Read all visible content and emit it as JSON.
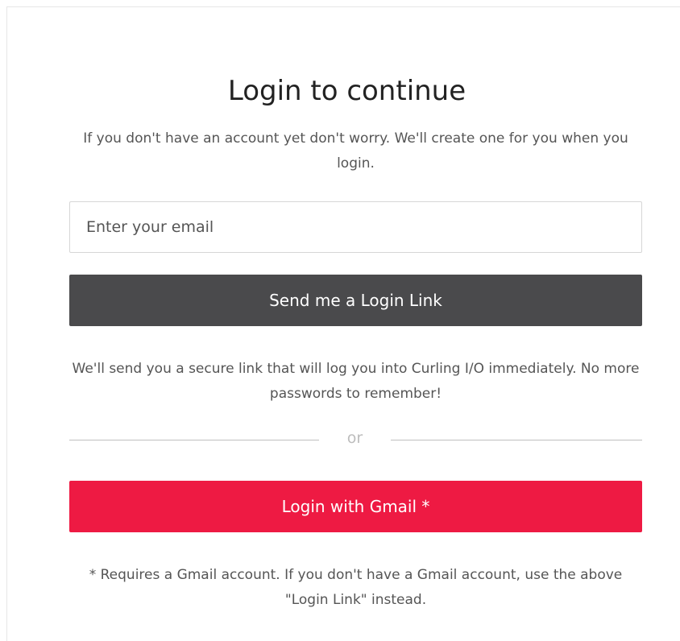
{
  "login": {
    "title": "Login to continue",
    "subtitle": "If you don't have an account yet don't worry. We'll create one for you when you login.",
    "email_placeholder": "Enter your email",
    "email_value": "",
    "send_link_label": "Send me a Login Link",
    "link_info": "We'll send you a secure link that will log you into Curling I/O immediately. No more passwords to remember!",
    "divider_label": "or",
    "gmail_label": "Login with Gmail *",
    "gmail_note": "* Requires a Gmail account. If you don't have a Gmail account, use the above \"Login Link\" instead."
  },
  "colors": {
    "send_link_button": "#4a4a4c",
    "gmail_button": "#ee1a43"
  }
}
